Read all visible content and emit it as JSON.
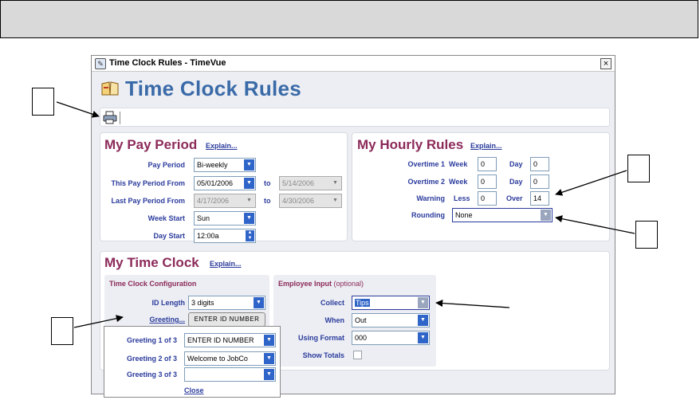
{
  "window": {
    "title": "Time Clock Rules - TimeVue",
    "close_glyph": "×"
  },
  "page": {
    "heading": "Time Clock Rules"
  },
  "pay_period": {
    "title": "My Pay Period",
    "explain": "Explain...",
    "pay_period_label": "Pay Period",
    "pay_period_value": "Bi-weekly",
    "this_from_label": "This Pay Period From",
    "this_from_value": "05/01/2006",
    "to_label": "to",
    "this_to_value": "5/14/2006",
    "last_from_label": "Last Pay Period From",
    "last_from_value": "4/17/2006",
    "last_to_value": "4/30/2006",
    "week_start_label": "Week Start",
    "week_start_value": "Sun",
    "day_start_label": "Day Start",
    "day_start_value": "12:00a"
  },
  "hourly_rules": {
    "title": "My Hourly Rules",
    "explain": "Explain...",
    "ot1_label": "Overtime 1",
    "ot2_label": "Overtime 2",
    "warning_label": "Warning",
    "week_label": "Week",
    "day_label": "Day",
    "less_label": "Less",
    "over_label": "Over",
    "ot1_week": "0",
    "ot1_day": "0",
    "ot2_week": "0",
    "ot2_day": "0",
    "warn_less": "0",
    "warn_over": "14",
    "rounding_label": "Rounding",
    "rounding_value": "None"
  },
  "time_clock": {
    "title": "My Time Clock",
    "explain": "Explain...",
    "config_title": "Time Clock Configuration",
    "id_length_label": "ID Length",
    "id_length_value": "3 digits",
    "greeting_link": "Greeting...",
    "greeting_preview": "ENTER ID NUMBER",
    "employee_input_title": "Employee Input",
    "optional": "(optional)",
    "collect_label": "Collect",
    "collect_value": "Tips",
    "when_label": "When",
    "when_value": "Out",
    "format_label": "Using Format",
    "format_value": "000",
    "show_totals_label": "Show Totals"
  },
  "greeting_popup": {
    "g1_label": "Greeting 1 of 3",
    "g1_value": "ENTER ID NUMBER",
    "g2_label": "Greeting 2 of 3",
    "g2_value": "Welcome to JobCo",
    "g3_label": "Greeting 3 of 3",
    "g3_value": "",
    "close": "Close"
  },
  "icons": [
    "app-icon",
    "book-icon",
    "print-icon",
    "dropdown-arrow-icon",
    "spinner-icon"
  ]
}
